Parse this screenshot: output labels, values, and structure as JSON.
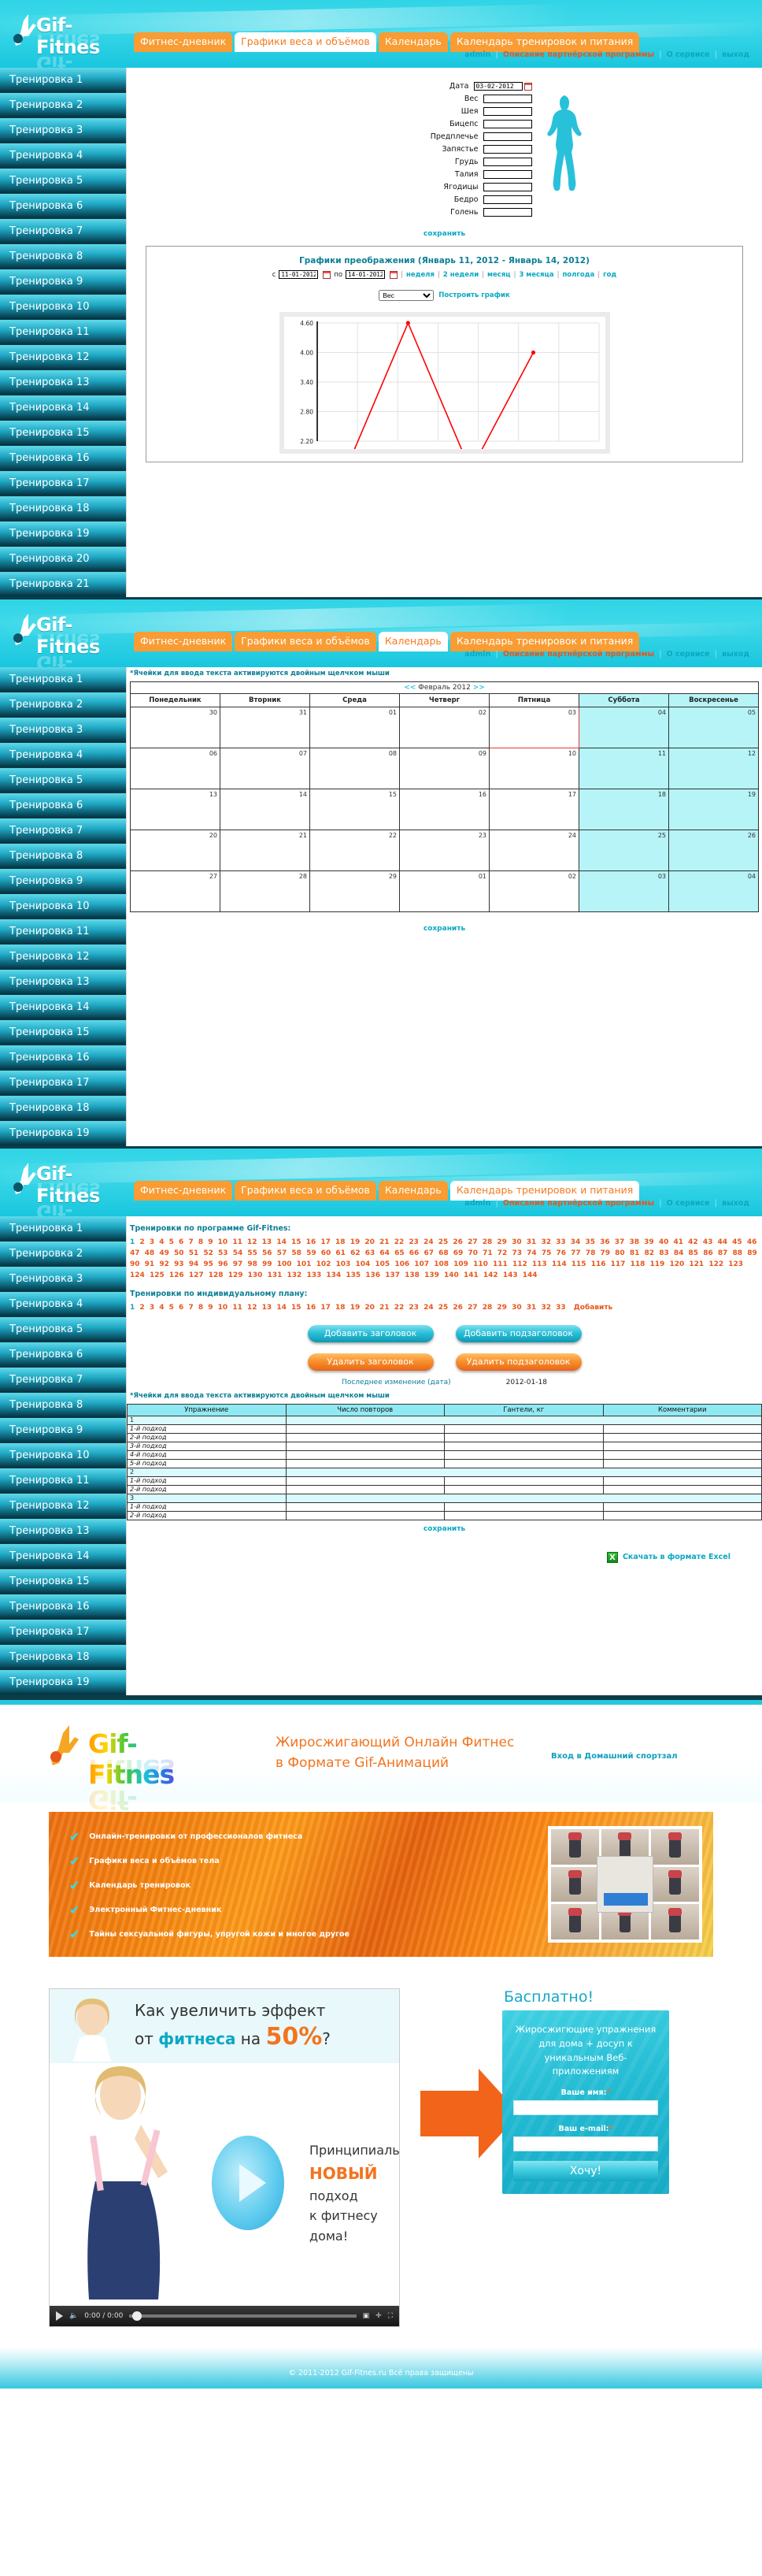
{
  "brand": {
    "name": "Gif-Fitnes",
    "logo_icon": "running-figure-icon"
  },
  "nav": {
    "tabs": [
      {
        "label": "Фитнес-дневник",
        "active": false
      },
      {
        "label": "Графики веса и объёмов",
        "active": true
      },
      {
        "label": "Календарь",
        "active": false
      },
      {
        "label": "Календарь тренировок и питания",
        "active": false
      }
    ],
    "tabs_screen2_active": "Календарь",
    "tabs_screen3_active": "Календарь тренировок и питания",
    "admin_links": [
      {
        "label": "admin",
        "style": "teal"
      },
      {
        "label": "Описание партнёрской программы",
        "style": "orange"
      },
      {
        "label": "О сервисе",
        "style": "teal"
      },
      {
        "label": "выход",
        "style": "teal"
      }
    ]
  },
  "sidebar": {
    "prefix": "Тренировка",
    "items_screen1": [
      "Тренировка 1",
      "Тренировка 2",
      "Тренировка 3",
      "Тренировка 4",
      "Тренировка 5",
      "Тренировка 6",
      "Тренировка 7",
      "Тренировка 8",
      "Тренировка 9",
      "Тренировка 10",
      "Тренировка 11",
      "Тренировка 12",
      "Тренировка 13",
      "Тренировка 14",
      "Тренировка 15",
      "Тренировка 16",
      "Тренировка 17",
      "Тренировка 18",
      "Тренировка 19",
      "Тренировка 20",
      "Тренировка 21"
    ],
    "items_screen2": [
      "Тренировка 1",
      "Тренировка 2",
      "Тренировка 3",
      "Тренировка 4",
      "Тренировка 5",
      "Тренировка 6",
      "Тренировка 7",
      "Тренировка 8",
      "Тренировка 9",
      "Тренировка 10",
      "Тренировка 11",
      "Тренировка 12",
      "Тренировка 13",
      "Тренировка 14",
      "Тренировка 15",
      "Тренировка 16",
      "Тренировка 17",
      "Тренировка 18",
      "Тренировка 19"
    ],
    "items_screen3": [
      "Тренировка 1",
      "Тренировка 2",
      "Тренировка 3",
      "Тренировка 4",
      "Тренировка 5",
      "Тренировка 6",
      "Тренировка 7",
      "Тренировка 8",
      "Тренировка 9",
      "Тренировка 10",
      "Тренировка 11",
      "Тренировка 12",
      "Тренировка 13",
      "Тренировка 14",
      "Тренировка 15",
      "Тренировка 16",
      "Тренировка 17",
      "Тренировка 18",
      "Тренировка 19"
    ]
  },
  "measure_form": {
    "fields": [
      {
        "label": "Дата",
        "value": "03-02-2012",
        "has_calendar": true
      },
      {
        "label": "Вес",
        "value": "",
        "has_calendar": false
      },
      {
        "label": "Шея",
        "value": "",
        "has_calendar": false
      },
      {
        "label": "Бицепс",
        "value": "",
        "has_calendar": false
      },
      {
        "label": "Предплечье",
        "value": "",
        "has_calendar": false
      },
      {
        "label": "Запястье",
        "value": "",
        "has_calendar": false
      },
      {
        "label": "Грудь",
        "value": "",
        "has_calendar": false
      },
      {
        "label": "Талия",
        "value": "",
        "has_calendar": false
      },
      {
        "label": "Ягодицы",
        "value": "",
        "has_calendar": false
      },
      {
        "label": "Бедро",
        "value": "",
        "has_calendar": false
      },
      {
        "label": "Голень",
        "value": "",
        "has_calendar": false
      }
    ],
    "save_label": "сохранить",
    "silhouette_icon": "female-body-silhouette-icon",
    "silhouette_color": "#29c0da"
  },
  "chart_panel": {
    "title": "Графики преображения (Январь 11, 2012 - Январь 14, 2012)",
    "from_prefix": "с",
    "from_value": "11-01-2012",
    "to_prefix": "по",
    "to_value": "14-01-2012",
    "presets": [
      "неделя",
      "2 недели",
      "месяц",
      "3 месяца",
      "полгода",
      "год"
    ],
    "metric_selected": "Вес",
    "build_label": "Построить график"
  },
  "chart_data": {
    "type": "line",
    "title": "Графики преображения (Январь 11, 2012 - Январь 14, 2012)",
    "xlabel": "",
    "ylabel": "Вес",
    "ylim": [
      2.2,
      4.6
    ],
    "yticks": [
      2.2,
      2.8,
      3.4,
      4.0,
      4.6
    ],
    "ytick_labels": [
      "2.20",
      "2.80",
      "3.40",
      "4.00",
      "4.60"
    ],
    "grid": true,
    "legend": "none",
    "line_color": "#ff0000",
    "marker_color": "#ff0000",
    "series": [
      {
        "name": "Вес",
        "x": [
          0,
          1,
          2,
          3
        ],
        "values": [
          1.6,
          4.6,
          1.6,
          4.0
        ]
      }
    ]
  },
  "calendar": {
    "note": "*Ячейки для ввода текста активируются двойным щелчком мыши",
    "month_label": "Февраль 2012",
    "prev_arrow": "<<",
    "next_arrow": ">>",
    "dow": [
      "Понедельник",
      "Вторник",
      "Среда",
      "Четверг",
      "Пятница",
      "Суббота",
      "Воскресенье"
    ],
    "weekend_index": [
      5,
      6
    ],
    "weeks": [
      [
        "30",
        "31",
        "01",
        "02",
        "03",
        "04",
        "05"
      ],
      [
        "06",
        "07",
        "08",
        "09",
        "10",
        "11",
        "12"
      ],
      [
        "13",
        "14",
        "15",
        "16",
        "17",
        "18",
        "19"
      ],
      [
        "20",
        "21",
        "22",
        "23",
        "24",
        "25",
        "26"
      ],
      [
        "27",
        "28",
        "29",
        "01",
        "02",
        "03",
        "04"
      ]
    ],
    "today": {
      "week": 0,
      "day": 4
    },
    "save_label": "сохранить"
  },
  "training": {
    "program_heading": "Тренировки по программе Gif-Fitnes:",
    "program_count": 144,
    "program_active": 1,
    "individual_heading": "Тренировки по индивидуальному плану:",
    "individual_count": 33,
    "add_label": "Добавить",
    "buttons": {
      "add_title": "Добавить заголовок",
      "add_subtitle": "Добавить подзаголовок",
      "del_title": "Удалить заголовок",
      "del_subtitle": "Удалить подзаголовок"
    },
    "last_modified_label": "Последнее изменение (дата)",
    "last_modified_value": "2012-01-18",
    "note": "*Ячейки для ввода текста активируются двойным щелчком мыши",
    "table_headers": [
      "Упражнение",
      "Число повторов",
      "Гантели, кг",
      "Комментарии"
    ],
    "groups": [
      {
        "name": "1",
        "sets": [
          "1-й подход",
          "2-й подход",
          "3-й подход",
          "4-й подход",
          "5-й подход"
        ]
      },
      {
        "name": "2",
        "sets": [
          "1-й подход",
          "2-й подход"
        ]
      },
      {
        "name": "3",
        "sets": [
          "1-й подход",
          "2-й подход"
        ]
      }
    ],
    "save_label": "сохранить",
    "excel_label": "Скачать в формате Excel",
    "excel_icon": "excel-file-icon"
  },
  "landing": {
    "logo_text": "Gif-Fitnes",
    "tagline_line1": "Жиросжигающий Онлайн Фитнес",
    "tagline_line2": "в Формате Gif-Анимаций",
    "login_link": "Вход в Домашний спортзал",
    "promo_bullets": [
      "Онлайн-тренировки от профессионалов фитнеса",
      "Графики веса и объёмов тела",
      "Календарь тренировок",
      "Электронный Фитнес-дневник",
      "Тайны сексуальной фигуры, упругой кожи и многое другое"
    ],
    "promo_check_icon": "check-mark-icon",
    "video": {
      "headline_a": "Как увеличить эффект",
      "headline_b": "от ",
      "headline_b_accent": "фитнеса",
      "headline_b_tail": " на ",
      "headline_percent": "50%",
      "headline_q": "?",
      "body_line1": "Принципиально",
      "body_new": "НОВЫЙ",
      "body_line2": "подход",
      "body_line3": "к фитнесу дома!",
      "play_icon": "play-button-icon",
      "time": "0:00 / 0:00",
      "volume_icon": "volume-icon",
      "fullscreen_icon": "fullscreen-icon",
      "settings_icon": "plus-icon",
      "popout_icon": "popout-icon"
    },
    "arrow_icon": "right-arrow-icon",
    "optin": {
      "free_label": "Басплатно!",
      "headline": "Жиросжигющие упражнения для дома + досуп к уникальным Веб-приложениям",
      "name_label": "Ваше имя:",
      "email_label": "Ваш e-mail:",
      "required_mark": "*",
      "name_value": "",
      "email_value": "",
      "submit_label": "Хочу!"
    },
    "footer": "© 2011-2012 Gif-Fitnes.ru Всё права защищены"
  },
  "colors": {
    "cyan": "#2fd4e6",
    "orange": "#f89c33",
    "orange_text": "#e8561d",
    "teal_text": "#0aa8c2",
    "chart_red": "#ff0000",
    "weekend_bg": "#b6f4f8"
  }
}
